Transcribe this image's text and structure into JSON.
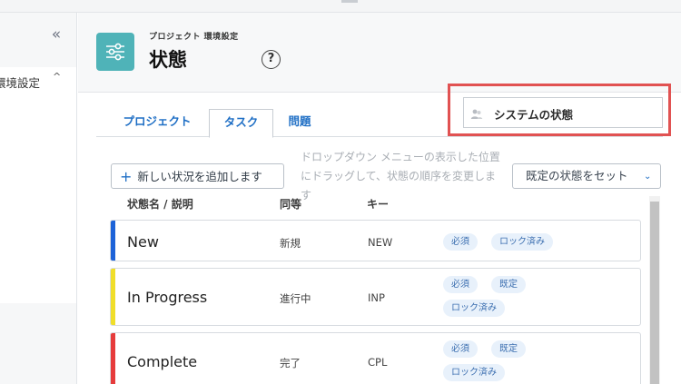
{
  "sidebar": {
    "collapse_glyph": "«",
    "item_label": "環境設定",
    "item_chevron": "^"
  },
  "header": {
    "subtitle": "プロジェクト 環境設定",
    "title": "状態",
    "help_glyph": "?"
  },
  "tabs": [
    {
      "label": "プロジェクト"
    },
    {
      "label": "タスク",
      "active": true
    },
    {
      "label": "問題"
    }
  ],
  "system_status": {
    "label": "システムの状態",
    "icon": "users-icon"
  },
  "toolbar": {
    "add_icon": "+",
    "add_label": "新しい状況を追加します",
    "hint": "ドロップダウン メニューの表示した位置にドラッグして、状態の順序を変更します",
    "default_label": "既定の状態をセット",
    "default_chevron": "⌄"
  },
  "table": {
    "headers": {
      "name": "状態名 / 説明",
      "equal": "同等",
      "key": "キー"
    },
    "rows": [
      {
        "name": "New",
        "equal": "新規",
        "key": "NEW",
        "color": "#1d63d8",
        "badges": [
          "必須",
          "ロック済み"
        ]
      },
      {
        "name": "In Progress",
        "equal": "進行中",
        "key": "INP",
        "color": "#f0de2a",
        "badges": [
          "必須",
          "既定",
          "ロック済み"
        ]
      },
      {
        "name": "Complete",
        "equal": "完了",
        "key": "CPL",
        "color": "#e63c3c",
        "badges": [
          "必須",
          "既定",
          "ロック済み"
        ]
      }
    ]
  },
  "colors": {
    "accent": "#1f6fc5",
    "header_icon": "#4fb3b8",
    "highlight_frame": "#e15252"
  }
}
